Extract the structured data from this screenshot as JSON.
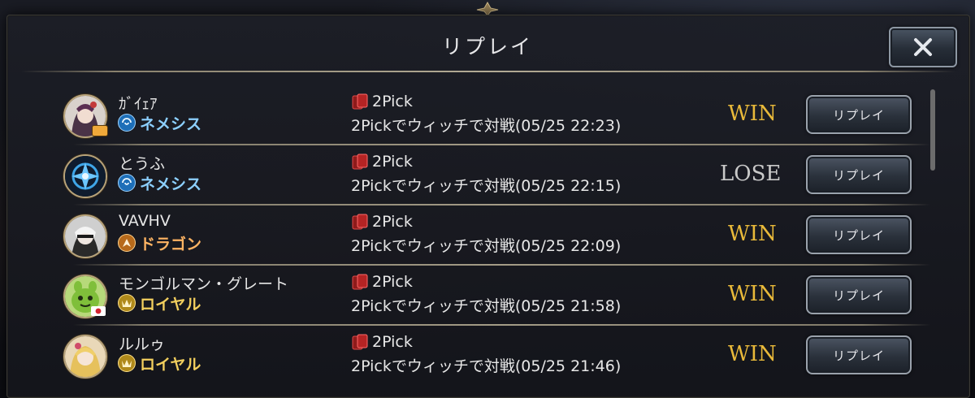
{
  "dialog": {
    "title": "リプレイ",
    "close_label": "✕"
  },
  "colors": {
    "win": "#e8b93a",
    "lose": "#c9c9c9",
    "nemesis": "#8dd0ff",
    "dragon": "#ffb463",
    "royal": "#f2cf5e"
  },
  "replays": [
    {
      "player": "ｶﾞｲｪｱ",
      "class": "ネメシス",
      "class_key": "nemesis",
      "mode": "2Pick",
      "description": "2Pickでウィッチで対戦(05/25 22:23)",
      "result": "WIN",
      "button": "リプレイ"
    },
    {
      "player": "とうふ",
      "class": "ネメシス",
      "class_key": "nemesis",
      "mode": "2Pick",
      "description": "2Pickでウィッチで対戦(05/25 22:15)",
      "result": "LOSE",
      "button": "リプレイ"
    },
    {
      "player": "VAVHV",
      "class": "ドラゴン",
      "class_key": "dragon",
      "mode": "2Pick",
      "description": "2Pickでウィッチで対戦(05/25 22:09)",
      "result": "WIN",
      "button": "リプレイ"
    },
    {
      "player": "モンゴルマン・グレート",
      "class": "ロイヤル",
      "class_key": "royal",
      "mode": "2Pick",
      "description": "2Pickでウィッチで対戦(05/25 21:58)",
      "result": "WIN",
      "button": "リプレイ"
    },
    {
      "player": "ルルゥ",
      "class": "ロイヤル",
      "class_key": "royal",
      "mode": "2Pick",
      "description": "2Pickでウィッチで対戦(05/25 21:46)",
      "result": "WIN",
      "button": "リプレイ"
    }
  ]
}
